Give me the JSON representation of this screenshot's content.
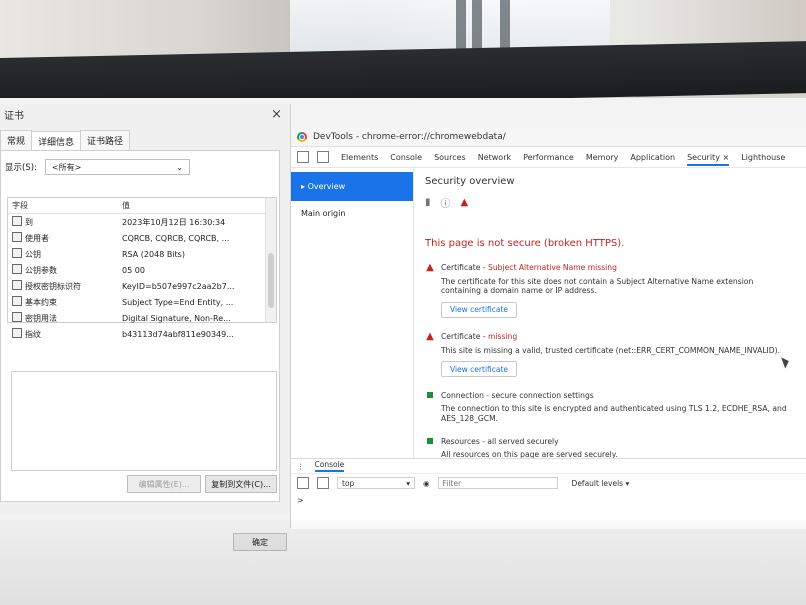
{
  "certificate_dialog": {
    "title": "证书",
    "close_glyph": "×",
    "tabs": [
      "常规",
      "详细信息",
      "证书路径"
    ],
    "show_label": "显示(S):",
    "show_value": "<所有>",
    "columns": [
      "字段",
      "值"
    ],
    "fields": [
      {
        "name": "到",
        "value": "2023年10月12日 16:30:34"
      },
      {
        "name": "使用者",
        "value": "CQRCB, CQRCB, CQRCB, ..."
      },
      {
        "name": "公钥",
        "value": "RSA (2048 Bits)"
      },
      {
        "name": "公钥参数",
        "value": "05 00"
      },
      {
        "name": "授权密钥标识符",
        "value": "KeyID=b507e997c2aa2b7..."
      },
      {
        "name": "基本约束",
        "value": "Subject Type=End Entity, ..."
      },
      {
        "name": "密钥用法",
        "value": "Digital Signature, Non-Re..."
      },
      {
        "name": "指纹",
        "value": "b43113d74abf811e90349..."
      }
    ],
    "buttons": {
      "edit_properties": "编辑属性(E)...",
      "copy_to_file": "复制到文件(C)...",
      "ok": "确定"
    }
  },
  "devtools": {
    "window_title": "DevTools - chrome-error://chromewebdata/",
    "tabs": [
      "Elements",
      "Console",
      "Sources",
      "Network",
      "Performance",
      "Memory",
      "Application",
      "Security",
      "Lighthouse"
    ],
    "active_tab": "Security",
    "active_tab_close": "×",
    "security": {
      "sidebar": {
        "overview": "Overview",
        "main_origin": "Main origin"
      },
      "heading": "Security overview",
      "status": "This page is not secure (broken HTTPS).",
      "items": [
        {
          "marker": "warning",
          "title": "Certificate",
          "subtitle": "Subject Alternative Name missing",
          "description": "The certificate for this site does not contain a Subject Alternative Name extension containing a domain name or IP address.",
          "button": "View certificate"
        },
        {
          "marker": "warning",
          "title": "Certificate",
          "subtitle": "missing",
          "description": "This site is missing a valid, trusted certificate (net::ERR_CERT_COMMON_NAME_INVALID).",
          "button": "View certificate"
        },
        {
          "marker": "secure",
          "title": "Connection",
          "subtitle": "secure connection settings",
          "description": "The connection to this site is encrypted and authenticated using TLS 1.2, ECDHE_RSA, and AES_128_GCM.",
          "button": ""
        },
        {
          "marker": "secure",
          "title": "Resources",
          "subtitle": "all served securely",
          "description": "All resources on this page are served securely.",
          "button": ""
        }
      ]
    },
    "console": {
      "tab": "Console",
      "context": "top",
      "filter_placeholder": "Filter",
      "levels": "Default levels ▾",
      "prompt": ">"
    }
  },
  "colors": {
    "accent": "#1a73e8",
    "warning": "#c5221f",
    "secure": "#1e8e3e"
  }
}
